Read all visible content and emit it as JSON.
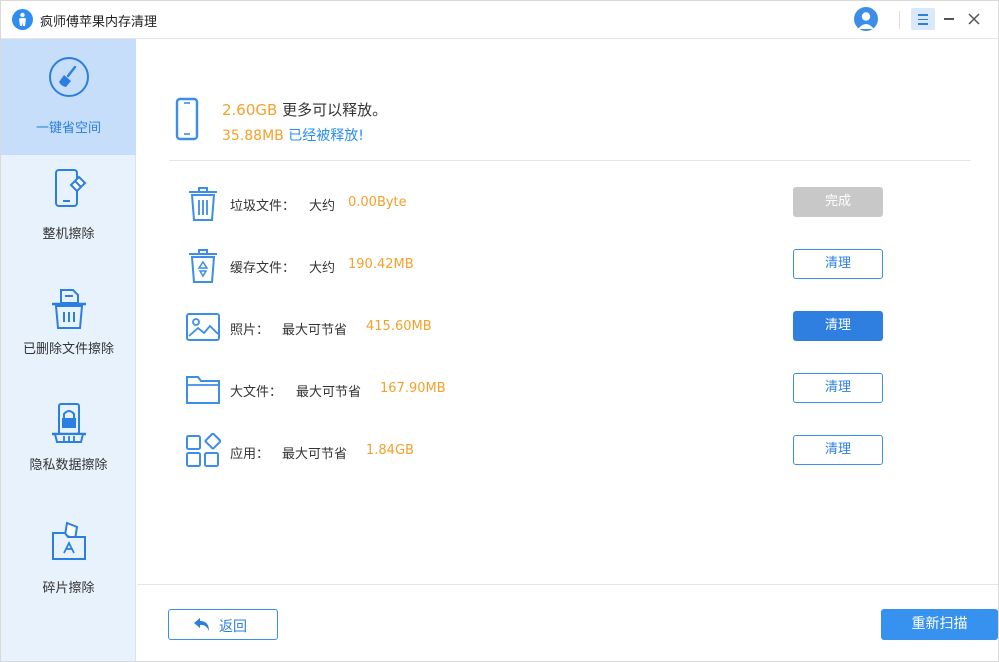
{
  "app": {
    "title": "疯师傅苹果内存清理"
  },
  "sidebar": {
    "items": [
      {
        "label": "一键省空间",
        "icon": "broom-icon",
        "active": true
      },
      {
        "label": "整机擦除",
        "icon": "phone-erase-icon",
        "active": false
      },
      {
        "label": "已删除文件擦除",
        "icon": "deleted-file-icon",
        "active": false
      },
      {
        "label": "隐私数据擦除",
        "icon": "privacy-lock-icon",
        "active": false
      },
      {
        "label": "碎片擦除",
        "icon": "fragment-folder-icon",
        "active": false
      }
    ]
  },
  "summary": {
    "freeable_amount": "2.60GB",
    "freeable_text": "更多可以释放。",
    "freed_amount": "35.88MB",
    "freed_text": "已经被释放!"
  },
  "rows": [
    {
      "label": "垃圾文件：",
      "desc": "大约",
      "size": "0.00Byte",
      "button": "完成",
      "icon": "trash-can-icon",
      "state": "done"
    },
    {
      "label": "缓存文件：",
      "desc": "大约",
      "size": "190.42MB",
      "button": "清理",
      "icon": "recycle-bin-icon",
      "state": "normal"
    },
    {
      "label": "照片：",
      "desc": "最大可节省",
      "size": "415.60MB",
      "button": "清理",
      "icon": "photo-icon",
      "state": "primary"
    },
    {
      "label": "大文件：",
      "desc": "最大可节省",
      "size": "167.90MB",
      "button": "清理",
      "icon": "folder-icon",
      "state": "normal"
    },
    {
      "label": "应用：",
      "desc": "最大可节省",
      "size": "1.84GB",
      "button": "清理",
      "icon": "apps-icon",
      "state": "normal"
    }
  ],
  "footer": {
    "back_label": "返回",
    "rescan_label": "重新扫描"
  },
  "colors": {
    "accent": "#2f7fe0",
    "orange": "#f5a02a",
    "sidebar_bg": "#e8f2fd",
    "sidebar_active": "#c6defa"
  }
}
